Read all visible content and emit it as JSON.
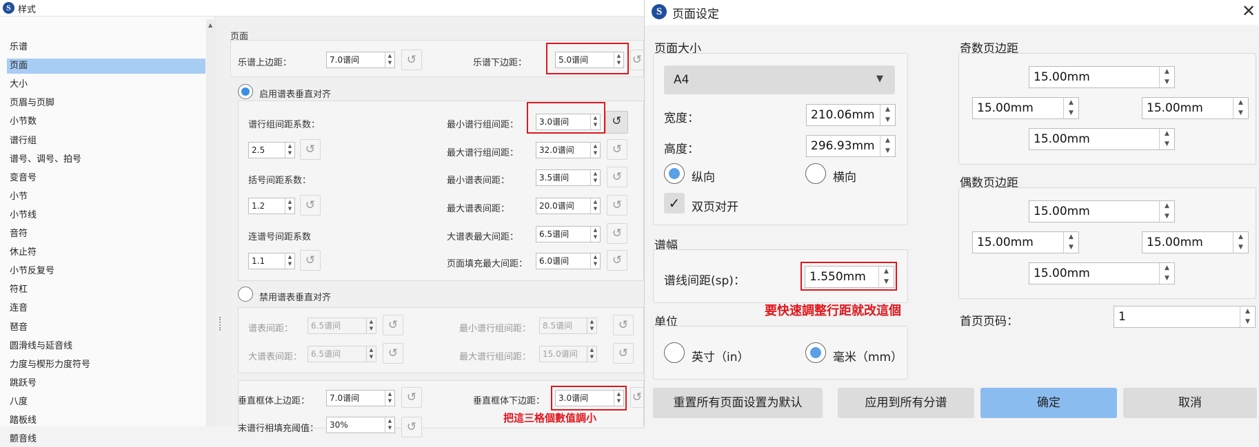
{
  "left_window": {
    "title": "样式",
    "sidebar_items": [
      "乐谱",
      "页面",
      "大小",
      "页眉与页脚",
      "小节数",
      "谱行组",
      "谱号、调号、拍号",
      "变音号",
      "小节",
      "小节线",
      "音符",
      "休止符",
      "小节反复号",
      "符杠",
      "连音",
      "琶音",
      "圆滑线与延音线",
      "力度与楔形力度符号",
      "跳跃号",
      "八度",
      "踏板线",
      "颤音线"
    ],
    "selected_item": "页面",
    "section_title": "页面",
    "top_margin_label": "乐谱上边距：",
    "top_margin_value": "7.0谱间",
    "bottom_margin_label": "乐谱下边距：",
    "bottom_margin_value": "5.0谱间",
    "enable_vjust_label": "启用谱表垂直对齐",
    "sys_dist_factor_label": "谱行组间距系数：",
    "sys_dist_factor_value": "2.5",
    "min_sys_dist_label": "最小谱行组间距：",
    "min_sys_dist_value": "3.0谱间",
    "max_sys_dist_label": "最大谱行组间距：",
    "max_sys_dist_value": "32.0谱间",
    "bracket_factor_label": "括号间距系数：",
    "bracket_factor_value": "1.2",
    "min_staff_dist_label": "最小谱表间距：",
    "min_staff_dist_value": "3.5谱间",
    "max_staff_dist_label": "最大谱表间距：",
    "max_staff_dist_value": "20.0谱间",
    "brace_factor_label": "连谱号间距系数",
    "brace_factor_value": "1.1",
    "max_brace_dist_label": "大谱表最大间距：",
    "max_brace_dist_value": "6.5谱间",
    "page_fill_label": "页面填充最大间距：",
    "page_fill_value": "6.0谱间",
    "disable_vjust_label": "禁用谱表垂直对齐",
    "d_staff_dist_label": "谱表间距：",
    "d_staff_dist_value": "6.5谱间",
    "d_min_sys_label": "最小谱行组间距：",
    "d_min_sys_value": "8.5谱间",
    "d_brace_dist_label": "大谱表间距：",
    "d_brace_dist_value": "6.5谱间",
    "d_max_sys_label": "最大谱行组间距：",
    "d_max_sys_value": "15.0谱间",
    "vframe_top_label": "垂直框体上边距：",
    "vframe_top_value": "7.0谱间",
    "vframe_bottom_label": "垂直框体下边距：",
    "vframe_bottom_value": "3.0谱间",
    "last_row_label": "末谱行相填充阈值：",
    "last_row_value": "30%",
    "annotation": "把這三格個數值調小"
  },
  "right_window": {
    "title": "页面设定",
    "page_size_title": "页面大小",
    "paper_select": "A4",
    "width_label": "宽度：",
    "width_value": "210.06mm",
    "height_label": "高度：",
    "height_value": "296.93mm",
    "portrait_label": "纵向",
    "landscape_label": "横向",
    "two_sided_label": "双页对开",
    "scale_title": "谱幅",
    "staff_space_label": "谱线间距(sp)：",
    "staff_space_value": "1.550mm",
    "annotation": "要快速調整行距就改這個",
    "units_title": "单位",
    "inch_label": "英寸（in）",
    "mm_label": "毫米（mm）",
    "odd_margins_title": "奇数页边距",
    "odd_top": "15.00mm",
    "odd_left": "15.00mm",
    "odd_right": "15.00mm",
    "odd_bottom": "15.00mm",
    "even_margins_title": "偶数页边距",
    "even_top": "15.00mm",
    "even_left": "15.00mm",
    "even_right": "15.00mm",
    "even_bottom": "15.00mm",
    "first_page_label": "首页页码：",
    "first_page_value": "1",
    "reset_button": "重置所有页面设置为默认",
    "apply_all_button": "应用到所有分谱",
    "ok_button": "确定",
    "cancel_button": "取消"
  },
  "colors": {
    "accent": "#3a8fe0",
    "annotation_red": "#e0161c",
    "selected": "#a7cdf4",
    "primary_button": "#8bbcf0"
  },
  "icons": [
    "musescore-logo-icon",
    "reset-icon",
    "close-icon",
    "chevron-down-icon",
    "checkmark-icon"
  ]
}
